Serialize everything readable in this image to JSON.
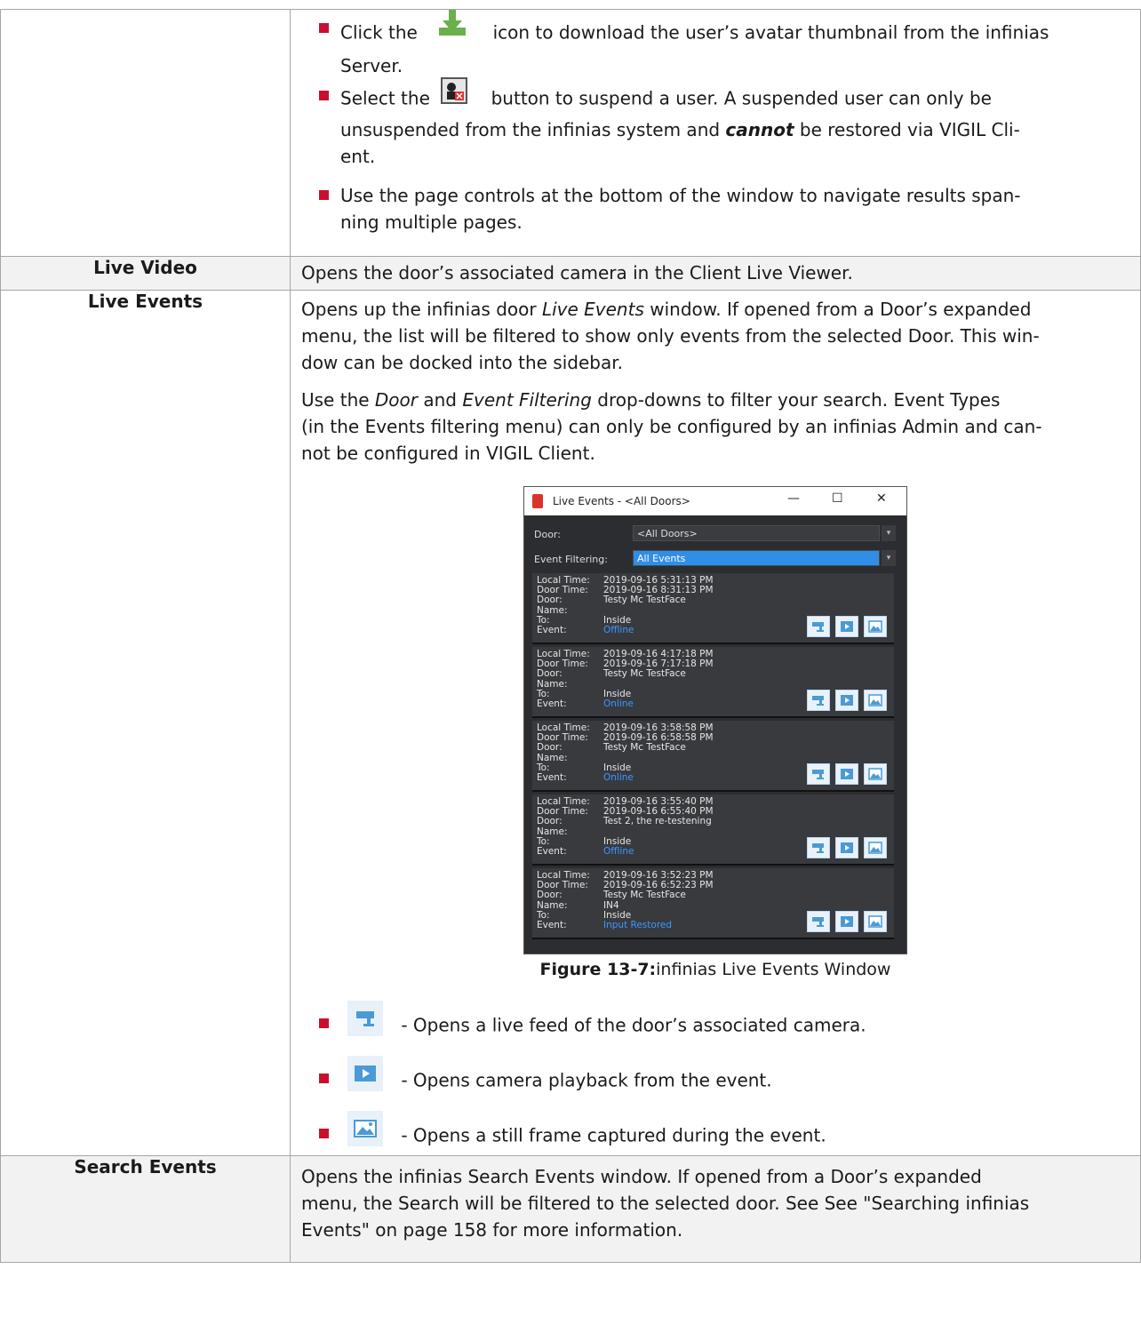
{
  "top_bullets": [
    {
      "before": "Click the",
      "after": "icon to download the user’s avatar thumbnail from the infinias",
      "line2": "Server.",
      "icon": "download-icon"
    },
    {
      "before": "Select the",
      "after": "button to suspend a user. A suspended user can only be",
      "line2_a": "unsuspended from the infinias system and ",
      "line2_em": "cannot",
      "line2_b": " be restored via VIGIL Cli-",
      "line3": "ent.",
      "icon": "suspend-user-icon"
    },
    {
      "line1": "Use the page controls at the bottom of the window to navigate results span-",
      "line2": "ning multiple pages."
    }
  ],
  "live_video": {
    "label": "Live Video",
    "desc": "Opens the door’s associated camera in the Client Live Viewer."
  },
  "live_events": {
    "label": "Live Events",
    "p1_l1_a": "Opens up the infinias door ",
    "p1_l1_em": "Live Events",
    "p1_l1_b": " window. If opened from a Door’s expanded",
    "p1_l2": "menu, the list will be filtered to show only events from the selected Door. This win-",
    "p1_l3": "dow can be docked into the sidebar.",
    "p2_l1_a": "Use the ",
    "p2_l1_em1": "Door",
    "p2_l1_b": " and ",
    "p2_l1_em2": "Event Filtering",
    "p2_l1_c": " drop-downs to filter your search. Event Types",
    "p2_l2": "(in the Events filtering menu) can only be configured by an infinias Admin and can-",
    "p2_l3": "not be configured in VIGIL Client.",
    "figure_label": "Figure 13-7:",
    "figure_title": "infinias Live Events Window",
    "icon_bullets": [
      {
        "text": "- Opens a live feed of the door’s associated camera.",
        "icon": "live-camera-icon"
      },
      {
        "text": "- Opens camera playback from the event.",
        "icon": "playback-icon"
      },
      {
        "text": "- Opens a still frame captured during the event.",
        "icon": "still-frame-icon"
      }
    ]
  },
  "window": {
    "title": "Live Events - <All Doors>",
    "door_label": "Door:",
    "door_value": "<All Doors>",
    "filter_label": "Event Filtering:",
    "filter_value": "All Events",
    "field_labels": [
      "Local Time:",
      "Door Time:",
      "Door:",
      "Name:",
      "To:",
      "Event:"
    ],
    "events": [
      {
        "local": "2019-09-16 5:31:13 PM",
        "door_time": "2019-09-16 8:31:13 PM",
        "door": "Testy Mc TestFace",
        "name": "",
        "to": "Inside",
        "event": "Offline"
      },
      {
        "local": "2019-09-16 4:17:18 PM",
        "door_time": "2019-09-16 7:17:18 PM",
        "door": "Testy Mc TestFace",
        "name": "",
        "to": "Inside",
        "event": "Online"
      },
      {
        "local": "2019-09-16 3:58:58 PM",
        "door_time": "2019-09-16 6:58:58 PM",
        "door": "Testy Mc TestFace",
        "name": "",
        "to": "Inside",
        "event": "Online"
      },
      {
        "local": "2019-09-16 3:55:40 PM",
        "door_time": "2019-09-16 6:55:40 PM",
        "door": "Test 2, the re-testening",
        "name": "",
        "to": "Inside",
        "event": "Offline"
      },
      {
        "local": "2019-09-16 3:52:23 PM",
        "door_time": "2019-09-16 6:52:23 PM",
        "door": "Testy Mc TestFace",
        "name": "IN4",
        "to": "Inside",
        "event": "Input Restored"
      }
    ]
  },
  "search_events": {
    "label": "Search Events",
    "l1": "Opens the infinias Search Events window. If opened from a Door’s expanded",
    "l2": "menu, the Search will be filtered to the selected door. See See \"Searching infinias",
    "l3": "Events\" on page 158 for more information."
  },
  "colors": {
    "bullet": "#c8102e",
    "shade": "#f2f2f2",
    "link_blue": "#3d97ff",
    "filter_highlight": "#2f8fe8"
  }
}
